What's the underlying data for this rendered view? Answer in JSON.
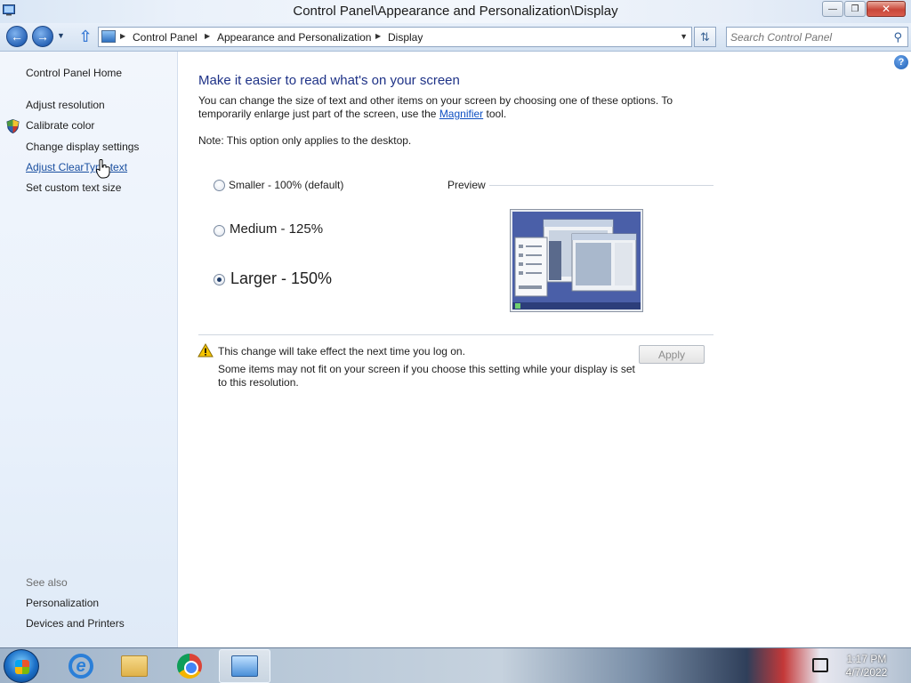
{
  "window": {
    "title": "Control Panel\\Appearance and Personalization\\Display"
  },
  "nav": {
    "breadcrumbs": [
      "Control Panel",
      "Appearance and Personalization",
      "Display"
    ],
    "search_placeholder": "Search Control Panel"
  },
  "sidebar": {
    "home": "Control Panel Home",
    "items": [
      {
        "label": "Adjust resolution"
      },
      {
        "label": "Calibrate color"
      },
      {
        "label": "Change display settings"
      },
      {
        "label": "Adjust ClearType text"
      },
      {
        "label": "Set custom text size"
      }
    ],
    "see_also_label": "See also",
    "see_also": [
      {
        "label": "Personalization"
      },
      {
        "label": "Devices and Printers"
      }
    ]
  },
  "main": {
    "heading": "Make it easier to read what's on your screen",
    "description_pre": "You can change the size of text and other items on your screen by choosing one of these options. To temporarily enlarge just part of the screen, use the ",
    "magnifier_link": "Magnifier",
    "description_post": " tool.",
    "note": "Note: This option only applies to the desktop.",
    "options": [
      {
        "label": "Smaller - 100% (default)",
        "checked": false
      },
      {
        "label": "Medium - 125%",
        "checked": false
      },
      {
        "label": "Larger - 150%",
        "checked": true
      }
    ],
    "preview_label": "Preview",
    "warning_title": "This change will take effect the next time you log on.",
    "warning_detail": "Some items may not fit on your screen if you choose this setting while your display is set to this resolution.",
    "apply_label": "Apply"
  },
  "taskbar": {
    "time": "1:17 PM",
    "date": "4/7/2022",
    "apps": [
      "internet-explorer",
      "windows-explorer",
      "google-chrome",
      "control-panel"
    ]
  },
  "colors": {
    "heading": "#1e3287",
    "link": "#0d4fc2",
    "sidebar_bg": "#eaf1fb"
  }
}
